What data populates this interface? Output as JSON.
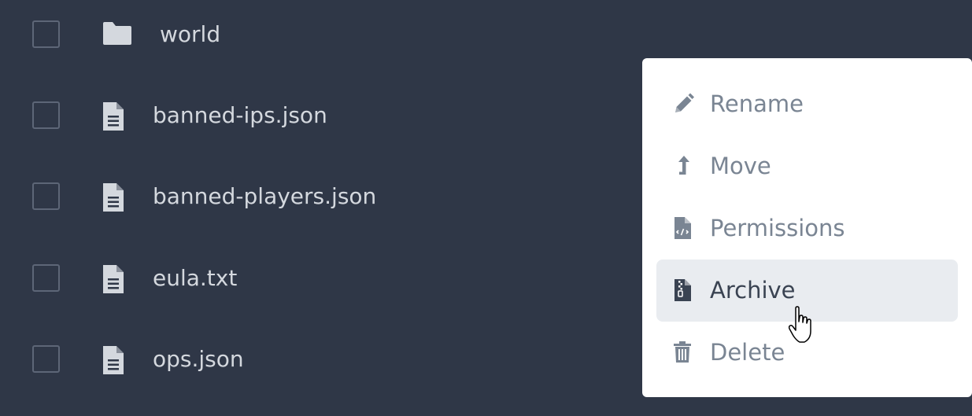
{
  "files": [
    {
      "name": "world",
      "type": "folder"
    },
    {
      "name": "banned-ips.json",
      "type": "file"
    },
    {
      "name": "banned-players.json",
      "type": "file"
    },
    {
      "name": "eula.txt",
      "type": "file"
    },
    {
      "name": "ops.json",
      "type": "file"
    }
  ],
  "context_menu": {
    "items": [
      {
        "label": "Rename",
        "icon": "pencil-icon"
      },
      {
        "label": "Move",
        "icon": "arrow-up-icon"
      },
      {
        "label": "Permissions",
        "icon": "file-code-icon"
      },
      {
        "label": "Archive",
        "icon": "file-zip-icon",
        "active": true
      },
      {
        "label": "Delete",
        "icon": "trash-icon"
      }
    ]
  },
  "colors": {
    "background": "#2f3747",
    "menu_background": "#ffffff",
    "menu_hover": "#e9ecf0",
    "menu_text": "#7a8593",
    "file_text": "#d4d8de"
  }
}
